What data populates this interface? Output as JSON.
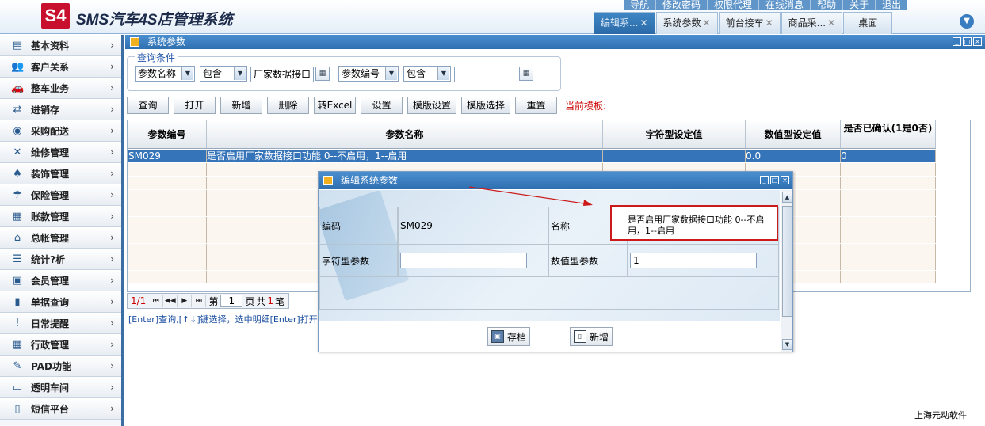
{
  "header": {
    "logo": "S4",
    "app_title": "SMS汽车4S店管理系统",
    "top_links": [
      "导航",
      "修改密码",
      "权限代理",
      "在线消息",
      "帮助",
      "关于",
      "退出"
    ],
    "tabs": [
      {
        "label": "编辑系...",
        "close": "✕"
      },
      {
        "label": "系统参数",
        "close": "✕"
      },
      {
        "label": "前台接车",
        "close": "✕"
      },
      {
        "label": "商品采...",
        "close": "✕"
      },
      {
        "label": "桌面",
        "close": ""
      }
    ]
  },
  "sidebar": {
    "items": [
      {
        "label": "基本资料",
        "icon": "▤"
      },
      {
        "label": "客户关系",
        "icon": "👥"
      },
      {
        "label": "整车业务",
        "icon": "🚗"
      },
      {
        "label": "进销存",
        "icon": "⇄"
      },
      {
        "label": "采购配送",
        "icon": "◉"
      },
      {
        "label": "维修管理",
        "icon": "✕"
      },
      {
        "label": "装饰管理",
        "icon": "♠"
      },
      {
        "label": "保险管理",
        "icon": "☂"
      },
      {
        "label": "账款管理",
        "icon": "▦"
      },
      {
        "label": "总帐管理",
        "icon": "⌂"
      },
      {
        "label": "统计?析",
        "icon": "☰"
      },
      {
        "label": "会员管理",
        "icon": "▣"
      },
      {
        "label": "单据查询",
        "icon": "▮"
      },
      {
        "label": "日常提醒",
        "icon": "!"
      },
      {
        "label": "行政管理",
        "icon": "▦"
      },
      {
        "label": "PAD功能",
        "icon": "✎"
      },
      {
        "label": "透明车间",
        "icon": "▭"
      },
      {
        "label": "短信平台",
        "icon": "▯"
      }
    ]
  },
  "panel": {
    "title": "系统参数"
  },
  "query": {
    "legend": "查询条件",
    "field1": "参数名称",
    "op1": "包含",
    "value1": "厂家数据接口",
    "field2": "参数编号",
    "op2": "包含",
    "value2": ""
  },
  "toolbar": {
    "buttons": [
      "查询",
      "打开",
      "新增",
      "删除",
      "转Excel",
      "设置",
      "模版设置",
      "模版选择",
      "重置"
    ],
    "current_template": "当前模板:"
  },
  "grid": {
    "columns": [
      "参数编号",
      "参数名称",
      "字符型设定值",
      "数值型设定值",
      "是否已确认(1是0否)"
    ],
    "rows": [
      [
        "SM029",
        "是否启用厂家数据接口功能 0--不启用，1--启用",
        "",
        "0.0",
        "0"
      ]
    ]
  },
  "pager": {
    "page_indicator": "1/1",
    "label_di": "第",
    "page_num": "1",
    "label_ye": "页",
    "label_gong": "共",
    "total": "1",
    "label_bi": "笔"
  },
  "hint": "[Enter]查询,[↑↓]键选择，选中明细[Enter]打开，",
  "dialog": {
    "title": "编辑系统参数",
    "code_label": "编码",
    "code_value": "SM029",
    "name_label": "名称",
    "name_value": "是否启用厂家数据接口功能 0--不启用，1--启用",
    "str_label": "字符型参数",
    "str_value": "",
    "num_label": "数值型参数",
    "num_value": "1",
    "save_label": "存档",
    "new_label": "新增"
  },
  "footer": "上海元动软件",
  "colors": {
    "accent": "#2f6fb0",
    "selected_row": "#3574b8",
    "highlight": "#cc1a1a"
  }
}
